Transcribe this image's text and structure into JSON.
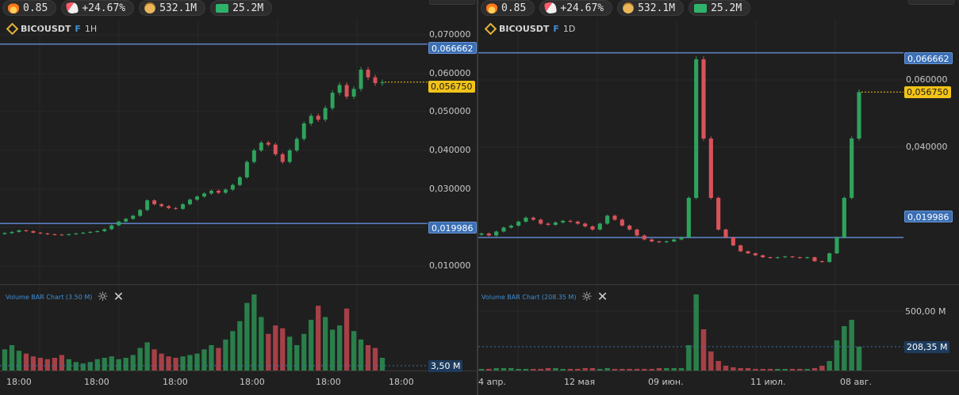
{
  "stats": [
    {
      "icon": "fire-icon",
      "value": "0.85"
    },
    {
      "icon": "rocket-icon",
      "value": "+24.67%"
    },
    {
      "icon": "money-bag-icon",
      "value": "532.1M"
    },
    {
      "icon": "cash-icon",
      "value": "25.2M"
    }
  ],
  "colors": {
    "up": "#2ea35b",
    "down": "#d9535a",
    "level": "#5b7fbf",
    "last": "#f2c318",
    "grid": "#2a2a2a"
  },
  "left": {
    "symbol": "BICOUSDT",
    "contract": "F",
    "timeframe": "1H",
    "price_ticks": [
      "0,070000",
      "0,060000",
      "0,050000",
      "0,040000",
      "0,030000",
      "0,020000",
      "0,010000"
    ],
    "level_high": "0,066662",
    "level_low": "0,019986",
    "last_price": "0,056750",
    "volume_title": "Volume BAR Chart (3.50 M)",
    "volume_label": "3,50 M",
    "time_labels": [
      "18:00",
      "18:00",
      "18:00",
      "18:00",
      "18:00",
      "18:00"
    ]
  },
  "right": {
    "symbol": "BICOUSDT",
    "contract": "F",
    "timeframe": "1D",
    "price_ticks": [
      "0,060000",
      "0,040000"
    ],
    "level_high": "0,066662",
    "level_low": "0,019986",
    "last_price": "0,056750",
    "volume_title": "Volume BAR Chart (208.35 M)",
    "volume_ticks": [
      "500,00 M"
    ],
    "volume_label": "208,35 M",
    "time_labels": [
      "4 апр.",
      "12 мая",
      "09 июн.",
      "11 июл.",
      "08 авг."
    ]
  },
  "chart_data": [
    {
      "type": "candlestick",
      "title": "BICOUSDT F 1H",
      "ylim": [
        0.004,
        0.074
      ],
      "levels": [
        0.066662,
        0.019986
      ],
      "last": 0.05675,
      "close": [
        0.0175,
        0.0178,
        0.0182,
        0.018,
        0.0176,
        0.0174,
        0.0172,
        0.0171,
        0.017,
        0.0172,
        0.0174,
        0.0176,
        0.0178,
        0.018,
        0.0185,
        0.0195,
        0.0205,
        0.0212,
        0.022,
        0.0235,
        0.026,
        0.025,
        0.0245,
        0.024,
        0.0238,
        0.025,
        0.0262,
        0.027,
        0.0278,
        0.0285,
        0.028,
        0.0288,
        0.03,
        0.032,
        0.036,
        0.039,
        0.041,
        0.0405,
        0.038,
        0.036,
        0.039,
        0.042,
        0.046,
        0.048,
        0.047,
        0.05,
        0.054,
        0.056,
        0.053,
        0.055,
        0.06,
        0.058,
        0.0565,
        0.05675
      ],
      "volume": [
        1.5,
        1.8,
        1.4,
        1.2,
        1.0,
        0.9,
        0.8,
        0.9,
        1.1,
        0.8,
        0.6,
        0.5,
        0.6,
        0.8,
        0.9,
        1.0,
        0.8,
        0.9,
        1.1,
        1.6,
        2.0,
        1.5,
        1.2,
        1.0,
        0.9,
        1.0,
        1.1,
        1.2,
        1.5,
        1.8,
        1.6,
        2.2,
        2.8,
        3.5,
        4.8,
        5.4,
        3.8,
        2.6,
        3.2,
        3.0,
        2.4,
        1.8,
        2.6,
        3.6,
        4.6,
        3.8,
        2.9,
        3.2,
        4.4,
        2.8,
        2.2,
        1.8,
        1.6,
        0.9
      ]
    },
    {
      "type": "candlestick",
      "title": "BICOUSDT F 1D",
      "ylim": [
        0.008,
        0.076
      ],
      "levels": [
        0.066662,
        0.019986
      ],
      "last": 0.05675,
      "close": [
        0.021,
        0.0205,
        0.0215,
        0.0225,
        0.023,
        0.024,
        0.025,
        0.0245,
        0.0235,
        0.0232,
        0.0238,
        0.0242,
        0.024,
        0.0235,
        0.0228,
        0.022,
        0.0235,
        0.0255,
        0.0245,
        0.023,
        0.022,
        0.0205,
        0.0195,
        0.019,
        0.0188,
        0.019,
        0.0195,
        0.02,
        0.03,
        0.065,
        0.045,
        0.03,
        0.022,
        0.02,
        0.018,
        0.0165,
        0.016,
        0.0155,
        0.015,
        0.0148,
        0.015,
        0.0152,
        0.015,
        0.0148,
        0.015,
        0.014,
        0.0138,
        0.016,
        0.02,
        0.03,
        0.045,
        0.05675
      ],
      "volume": [
        0.2,
        0.2,
        0.3,
        0.3,
        0.3,
        0.2,
        0.2,
        0.2,
        0.2,
        0.3,
        0.3,
        0.2,
        0.2,
        0.2,
        0.3,
        0.3,
        0.2,
        0.3,
        0.2,
        0.2,
        0.2,
        0.2,
        0.2,
        0.2,
        0.3,
        0.3,
        0.3,
        0.3,
        3.2,
        9.6,
        5.2,
        2.4,
        1.2,
        0.6,
        0.4,
        0.3,
        0.3,
        0.2,
        0.2,
        0.2,
        0.2,
        0.2,
        0.2,
        0.2,
        0.2,
        0.3,
        0.6,
        1.2,
        3.8,
        5.6,
        6.4,
        3.0
      ]
    }
  ]
}
